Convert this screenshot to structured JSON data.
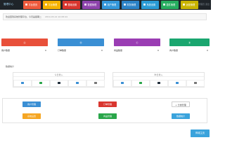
{
  "app": {
    "brand": "管理中心"
  },
  "nav": {
    "tabs": [
      {
        "label": "平台首页",
        "color": "#f05a3c"
      },
      {
        "label": "平台管理",
        "color": "#f6b300"
      },
      {
        "label": "基础设置",
        "color": "#d9362f"
      },
      {
        "label": "数据管理",
        "color": "#8e44ad"
      },
      {
        "label": "用户管理",
        "color": "#3498db"
      },
      {
        "label": "财务管理",
        "color": "#2c83c7"
      },
      {
        "label": "系统设置",
        "color": "#2a9bd6"
      },
      {
        "label": "插件管理",
        "color": "#27ae60"
      },
      {
        "label": "运营管理",
        "color": "#c9b400"
      }
    ],
    "right_text": "管理员 退出"
  },
  "breadcrumb": {
    "text": "欢迎回到系统管理平台，今天是星期二",
    "date": "2019-03-12 10:08:44"
  },
  "cards": [
    {
      "glyph": "Ⓐ",
      "color": "#e8503a",
      "label": "用户数量",
      "value": "0"
    },
    {
      "glyph": "Ⓑ",
      "color": "#3a8fd4",
      "label": "订单数量",
      "value": "0"
    },
    {
      "glyph": "Ⓒ",
      "color": "#9a3db3",
      "label": "商品数量",
      "value": "0"
    },
    {
      "glyph": "Ⓓ",
      "color": "#1aa66f",
      "label": "商户数量",
      "value": "0"
    }
  ],
  "stats": {
    "title": "数据统计",
    "panels": [
      {
        "title": "今日录入",
        "icon_colors": [
          "#3a8fd4",
          "#2aa64a",
          "#222f3c",
          "#3a8fd4",
          "#777777"
        ]
      },
      {
        "title": "昨日录入",
        "icon_colors": [
          "#3a8fd4",
          "#2aa64a",
          "#222f3c",
          "#3a8fd4",
          "#777777"
        ]
      }
    ]
  },
  "actions": [
    {
      "label": "用户管理",
      "color": "#3a8fd4",
      "outline": false
    },
    {
      "label": "订单管理",
      "color": "#d9362f",
      "outline": false
    },
    {
      "label": "+ 分类管理",
      "color": "#ffffff",
      "outline": true
    },
    {
      "label": "系统设置",
      "color": "#f5a623",
      "outline": false
    },
    {
      "label": "商品管理",
      "color": "#2aa64a",
      "outline": false
    },
    {
      "label": "数据统计",
      "color": "#3aa3dc",
      "outline": false
    }
  ],
  "cta": {
    "label": "商城主页"
  }
}
